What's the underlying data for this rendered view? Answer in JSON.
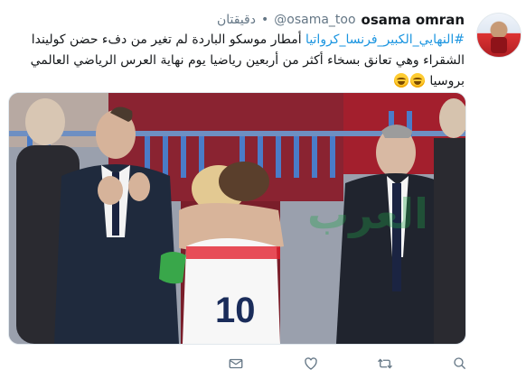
{
  "tweet": {
    "display_name": "osama omran",
    "handle": "@osama_too",
    "separator": "•",
    "time": "دقيقتان",
    "hashtag": "#النهايي_الكبير_فرنسا_كرواتيا",
    "text_line1": " أمطار موسكو الباردة لم تغير من دفء حضن كوليندا",
    "text_line2": "الشقراء وهي تعانق بسخاء أكثر من أربعين رياضيا يوم نهاية العرس الرياضي العالمي",
    "text_line3": "بروسيا"
  },
  "media": {
    "jersey_number": "10",
    "watermark": "العرب"
  },
  "actions": {
    "items": [
      {
        "icon": "reply-icon"
      },
      {
        "icon": "retweet-icon"
      },
      {
        "icon": "like-icon"
      },
      {
        "icon": "share-icon"
      }
    ]
  },
  "colors": {
    "hashtag": "#1b95e0",
    "text": "#14171a",
    "secondary": "#657786"
  }
}
